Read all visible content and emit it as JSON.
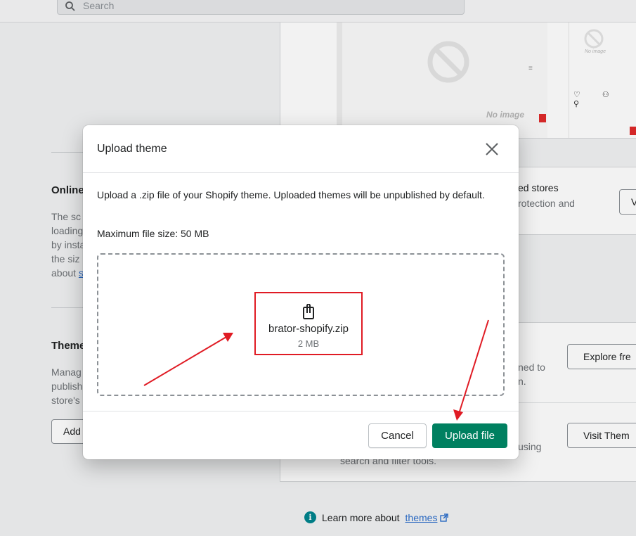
{
  "search": {
    "placeholder": "Search"
  },
  "preview": {
    "no_image_label": "No image",
    "no_image_small_label": "No image"
  },
  "online_store": {
    "title": "Online",
    "body_lines": [
      "The sc",
      "loading",
      "by insta",
      "the siz",
      "about"
    ],
    "link_fragment": "s"
  },
  "themes_section": {
    "title": "Theme",
    "body_lines": [
      "Manag",
      "publish",
      "store's"
    ],
    "add_button": "Add"
  },
  "right_cards": {
    "card1_line1": "ed stores",
    "card1_line2": "rotection and",
    "card1_button": "V",
    "card2_line1": "ned to",
    "card2_line2": "n.",
    "card2_button": "Explore fre",
    "card3_line1": "using",
    "card3_line2": "search and filter tools.",
    "card3_button": "Visit Them"
  },
  "footer": {
    "prefix": "Learn more about",
    "link": "themes"
  },
  "modal": {
    "title": "Upload theme",
    "description": "Upload a .zip file of your Shopify theme. Uploaded themes will be unpublished by default.",
    "max_size": "Maximum file size: 50 MB",
    "file_name": "brator-shopify.zip",
    "file_size": "2 MB",
    "cancel_label": "Cancel",
    "upload_label": "Upload file"
  },
  "colors": {
    "primary": "#008060",
    "annotation": "#e01b24",
    "link": "#2c6ecb"
  }
}
